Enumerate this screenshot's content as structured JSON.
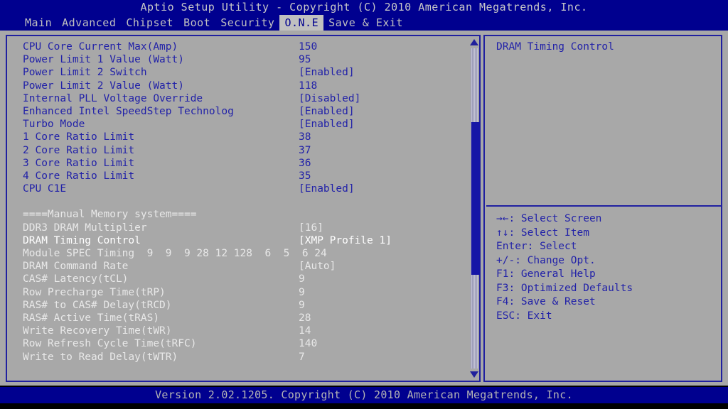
{
  "header": {
    "title": "Aptio Setup Utility - Copyright (C) 2010 American Megatrends, Inc."
  },
  "menubar": {
    "items": [
      {
        "label": "Main",
        "active": false
      },
      {
        "label": "Advanced",
        "active": false
      },
      {
        "label": "Chipset",
        "active": false
      },
      {
        "label": "Boot",
        "active": false
      },
      {
        "label": "Security",
        "active": false
      },
      {
        "label": "O.N.E",
        "active": true
      },
      {
        "label": "Save & Exit",
        "active": false
      }
    ]
  },
  "settings": {
    "rows": [
      {
        "label": "CPU Core Current Max(Amp)",
        "value": "150",
        "style": "blue"
      },
      {
        "label": "Power Limit 1 Value (Watt)",
        "value": "95",
        "style": "blue"
      },
      {
        "label": "Power Limit 2 Switch",
        "value": "[Enabled]",
        "style": "blue"
      },
      {
        "label": "Power Limit 2 Value (Watt)",
        "value": "118",
        "style": "blue"
      },
      {
        "label": "Internal PLL Voltage Override",
        "value": "[Disabled]",
        "style": "blue"
      },
      {
        "label": "Enhanced Intel SpeedStep Technolog",
        "value": "[Enabled]",
        "style": "blue"
      },
      {
        "label": "Turbo Mode",
        "value": "[Enabled]",
        "style": "blue"
      },
      {
        "label": "1 Core Ratio Limit",
        "value": "38",
        "style": "blue"
      },
      {
        "label": "2 Core Ratio Limit",
        "value": "37",
        "style": "blue"
      },
      {
        "label": "3 Core Ratio Limit",
        "value": "36",
        "style": "blue"
      },
      {
        "label": "4 Core Ratio Limit",
        "value": "35",
        "style": "blue"
      },
      {
        "label": "CPU C1E",
        "value": "[Enabled]",
        "style": "blue"
      },
      {
        "label": "",
        "value": "",
        "style": "spacer"
      },
      {
        "label": "====Manual Memory system====",
        "value": "",
        "style": "light"
      },
      {
        "label": "DDR3 DRAM Multiplier",
        "value": "[16]",
        "style": "light"
      },
      {
        "label": "DRAM Timing Control",
        "value": "[XMP Profile 1]",
        "style": "selected"
      },
      {
        "label": "Module SPEC Timing  9  9  9 28 12 128  6  5  6 24",
        "value": "",
        "style": "light"
      },
      {
        "label": "DRAM Command Rate",
        "value": "[Auto]",
        "style": "light"
      },
      {
        "label": "CAS# Latency(tCL)",
        "value": "9",
        "style": "light"
      },
      {
        "label": "Row Precharge Time(tRP)",
        "value": "9",
        "style": "light"
      },
      {
        "label": "RAS# to CAS# Delay(tRCD)",
        "value": "9",
        "style": "light"
      },
      {
        "label": "RAS# Active Time(tRAS)",
        "value": "28",
        "style": "light"
      },
      {
        "label": "Write Recovery Time(tWR)",
        "value": "14",
        "style": "light"
      },
      {
        "label": "Row Refresh Cycle Time(tRFC)",
        "value": "140",
        "style": "light"
      },
      {
        "label": "Write to Read Delay(tWTR)",
        "value": "7",
        "style": "light"
      }
    ]
  },
  "scrollbar": {
    "up_arrow": "scroll-up-arrow",
    "down_arrow": "scroll-down-arrow"
  },
  "help": {
    "title": "DRAM Timing Control",
    "legend": [
      "→←: Select Screen",
      "↑↓: Select Item",
      "Enter: Select",
      "+/-: Change Opt.",
      "F1: General Help",
      "F3: Optimized Defaults",
      "F4: Save & Reset",
      "ESC: Exit"
    ]
  },
  "footer": {
    "version": "Version 2.02.1205. Copyright (C) 2010 American Megatrends, Inc."
  }
}
